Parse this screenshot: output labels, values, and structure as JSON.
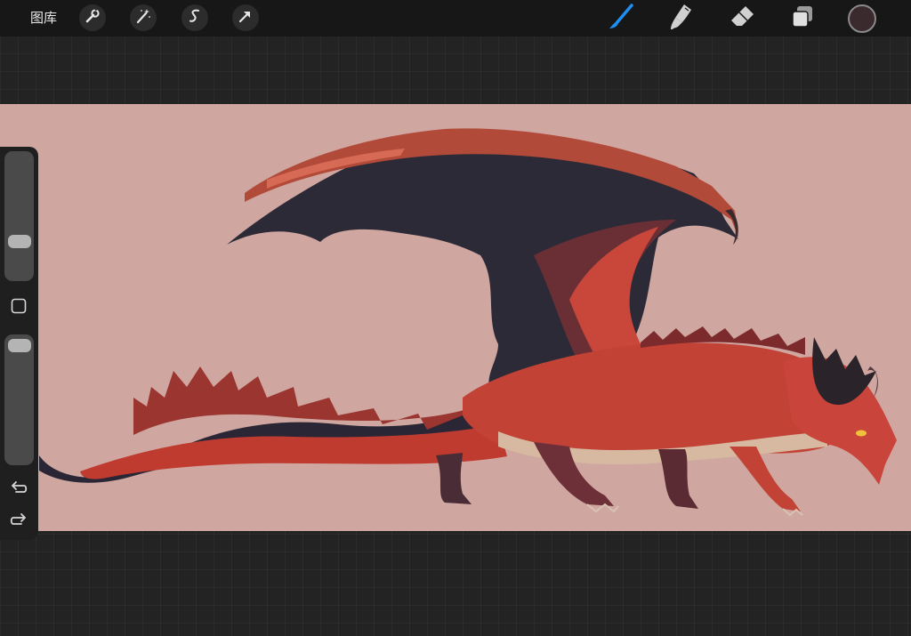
{
  "toolbar": {
    "gallery_label": "图库",
    "left_tools": [
      "wrench-icon",
      "magic-wand-icon",
      "selection-s-icon",
      "transform-arrow-icon"
    ],
    "right_tools": [
      "brush-icon",
      "smudge-icon",
      "eraser-icon",
      "layers-icon"
    ],
    "active_tool": "brush-icon",
    "active_color": "#3a2a2e",
    "accent_color": "#1f8ef1"
  },
  "canvas": {
    "background_color": "#cfa7a0",
    "artwork": "red-dragon"
  },
  "sidebar": {
    "brush_size_level": 0.68,
    "opacity_level": 0.0,
    "icons": [
      "modify-square-icon",
      "undo-icon",
      "redo-icon"
    ]
  }
}
